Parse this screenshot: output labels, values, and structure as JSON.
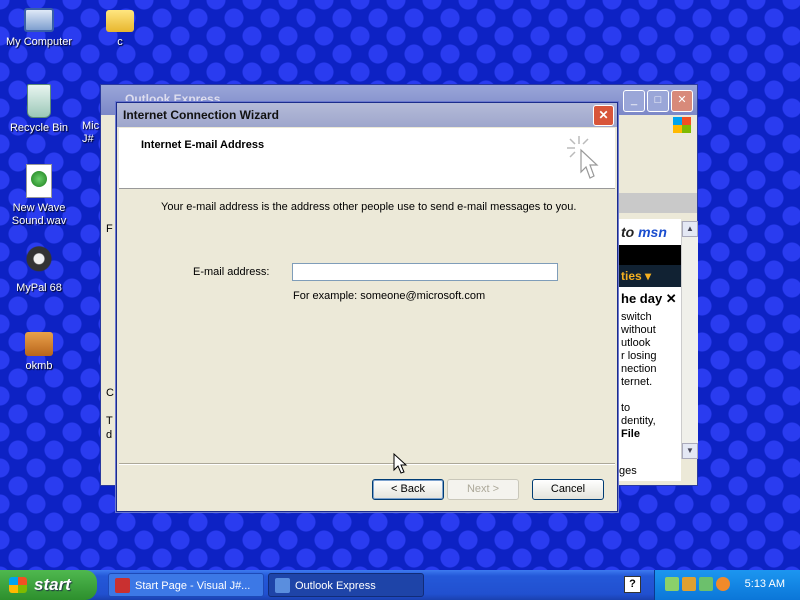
{
  "desktop": {
    "icons": [
      {
        "label": "My Computer"
      },
      {
        "label": "c"
      },
      {
        "label": "Recycle Bin"
      },
      {
        "label": "New Wave\nSound.wav"
      },
      {
        "label": "MyPal 68"
      },
      {
        "label": "okmb"
      }
    ],
    "partial_label": "Mic\nJ#"
  },
  "background_window": {
    "title": "Outlook Express",
    "msn_logo": "msn",
    "msn_prefix": "to",
    "msn_bar": "ties",
    "msn_day": "he day",
    "msn_text": [
      "switch",
      "without",
      "utlook",
      "r losing",
      "nection",
      "ternet.",
      "",
      "to",
      "dentity,",
      "File"
    ],
    "status": "ges",
    "left_fragments": [
      "F",
      "C",
      "T",
      "d"
    ]
  },
  "wizard": {
    "title": "Internet Connection Wizard",
    "heading": "Internet E-mail Address",
    "description": "Your e-mail address is the address other people use to send e-mail messages to you.",
    "email_label": "E-mail address:",
    "email_value": "",
    "email_example": "For example: someone@microsoft.com",
    "back_label": "< Back",
    "next_label": "Next >",
    "cancel_label": "Cancel"
  },
  "taskbar": {
    "start_label": "start",
    "tasks": [
      {
        "label": "Start Page - Visual J#...",
        "icon": "vjs-icon"
      },
      {
        "label": "Outlook Express",
        "icon": "outlook-icon"
      }
    ],
    "help": "?",
    "clock": "5:13 AM"
  },
  "colors": {
    "desktop": "#0d22c4",
    "title_inactive": "#9ea6cc",
    "close_red": "#d8553a",
    "taskbar": "#2150d0",
    "start_green": "#2d8f2d"
  }
}
